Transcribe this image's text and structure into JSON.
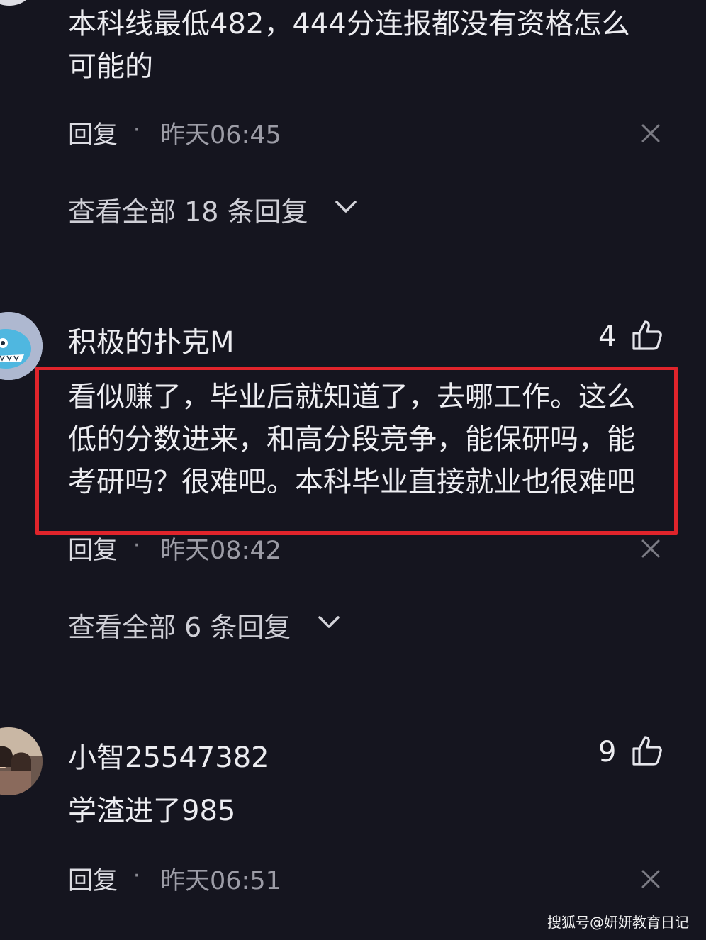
{
  "comment1": {
    "text_line1": "本科线最低482，444分连报都没有资格怎么",
    "text_line2": "可能的",
    "reply_label": "回复",
    "separator": "·",
    "time": "昨天06:45",
    "view_all": "查看全部 18 条回复"
  },
  "comment2": {
    "username": "积极的扑克M",
    "likes": "4",
    "text_lines": [
      "看似赚了，毕业后就知道了，去哪工作。这么",
      "低的分数进来，和高分段竞争，能保研吗，能",
      "考研吗？很难吧。本科毕业直接就业也很难吧"
    ],
    "reply_label": "回复",
    "separator": "·",
    "time": "昨天08:42",
    "view_all": "查看全部 6 条回复"
  },
  "comment3": {
    "username": "小智25547382",
    "likes": "9",
    "text": "学渣进了985",
    "reply_label": "回复",
    "separator": "·",
    "time": "昨天06:51"
  },
  "watermark": "搜狐号@妍妍教育日记",
  "colors": {
    "background": "#15151f",
    "highlight": "#e0242b"
  },
  "icons": [
    "close-icon",
    "chevron-down-icon",
    "thumbs-up-icon"
  ]
}
